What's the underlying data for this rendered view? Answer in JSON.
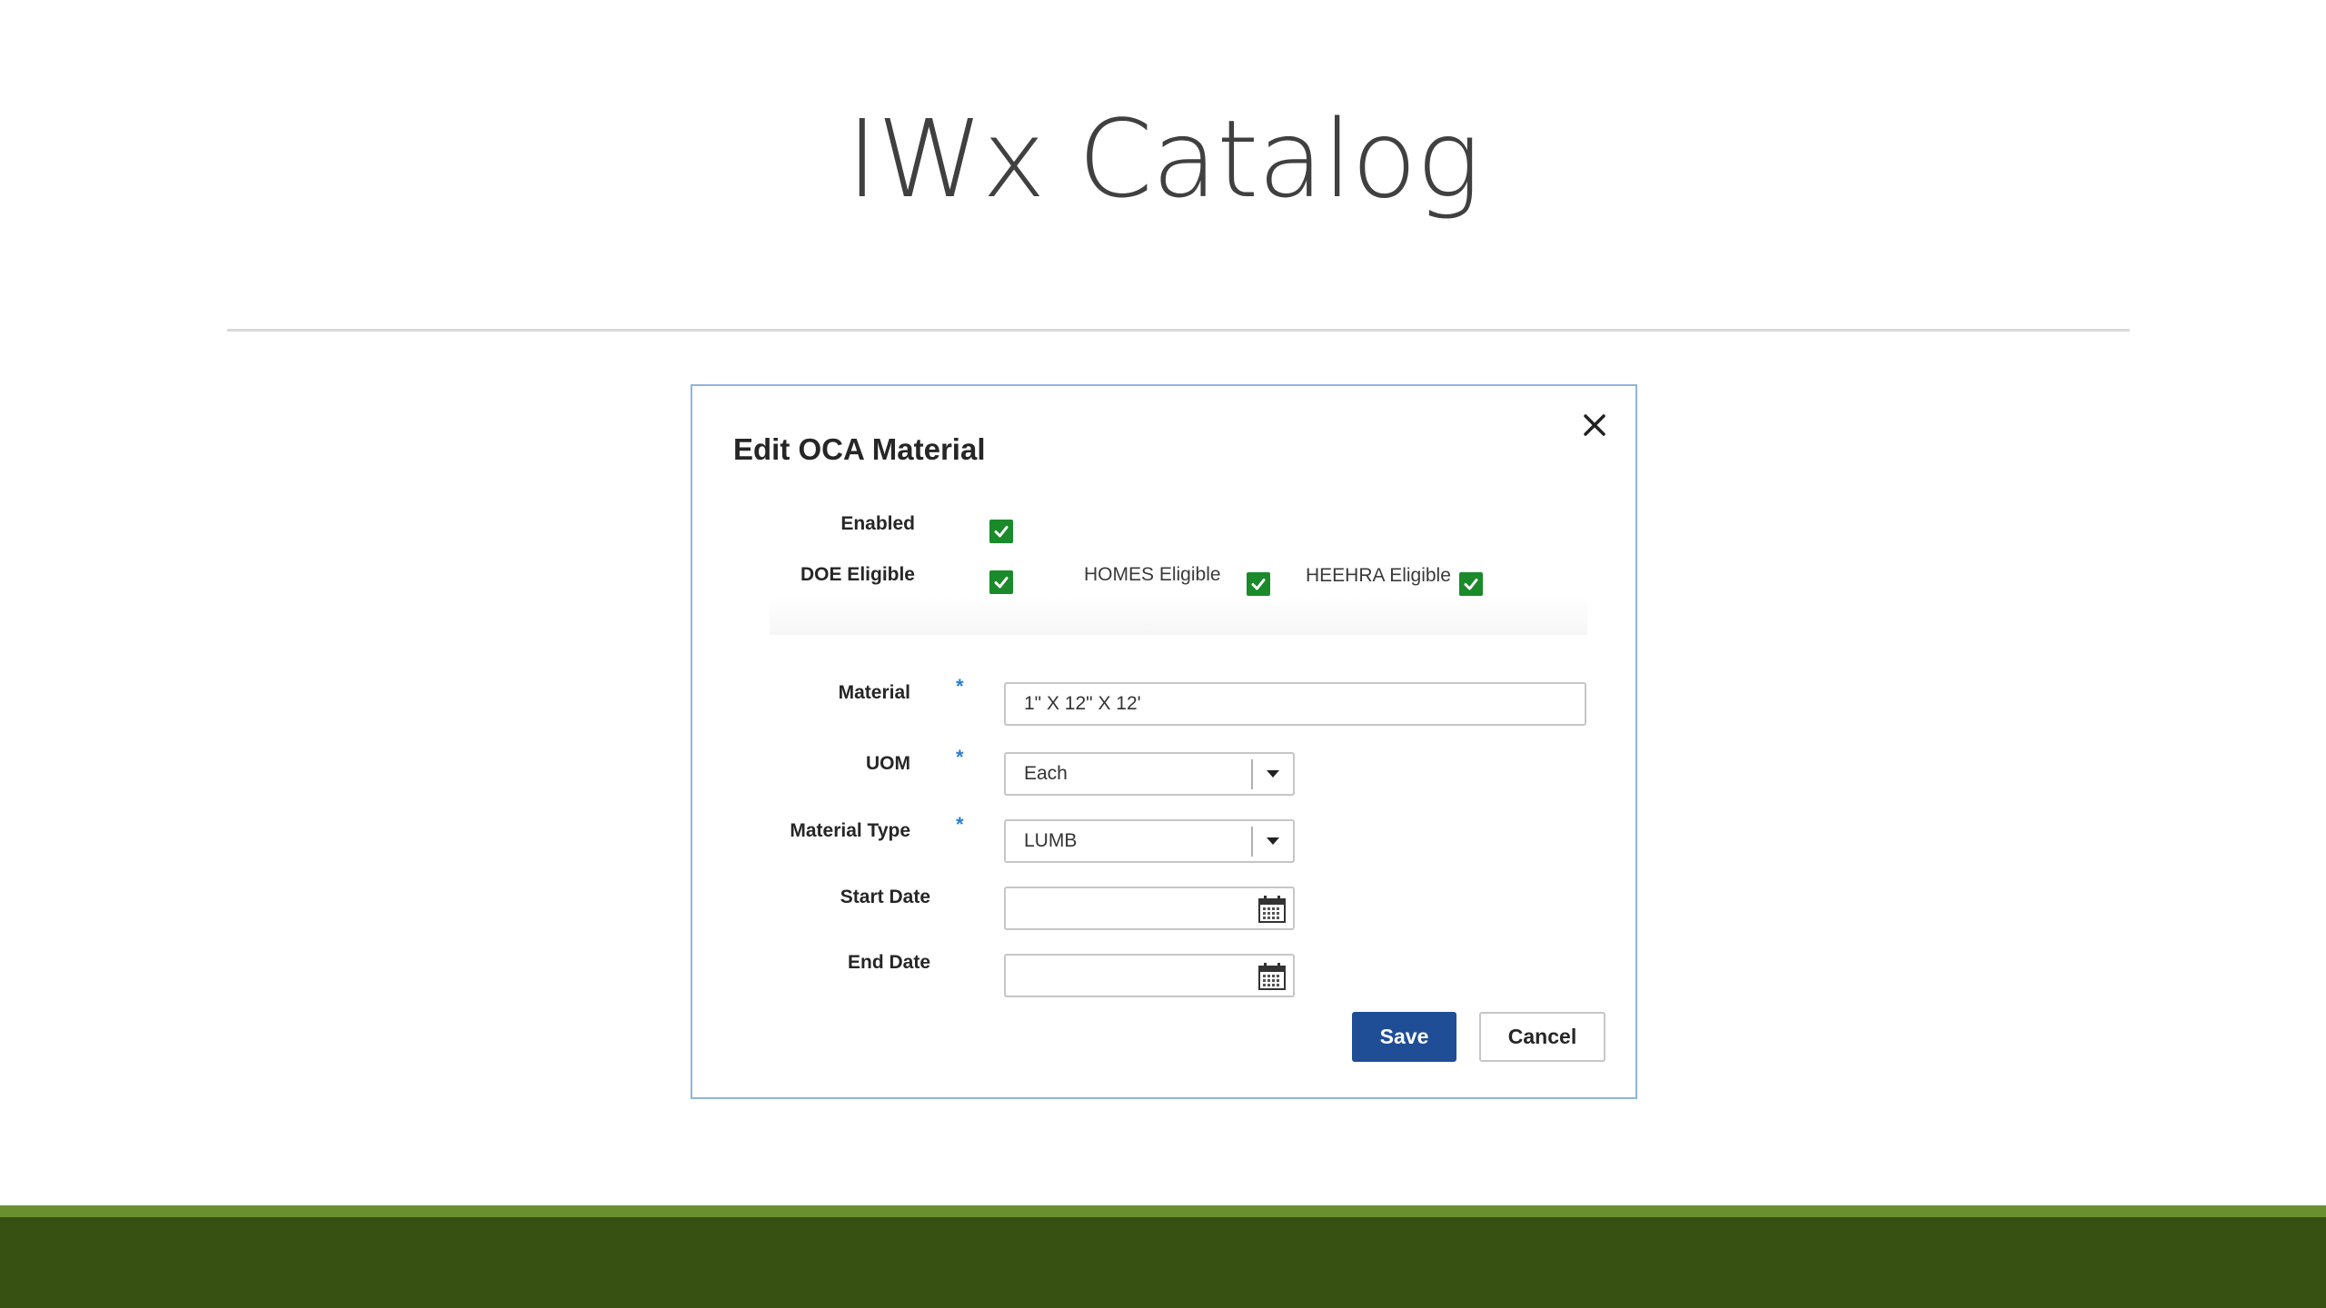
{
  "slide": {
    "title": "IWx Catalog"
  },
  "dialog": {
    "title": "Edit OCA Material",
    "close_icon": "close-icon",
    "checkboxes": {
      "enabled": {
        "label": "Enabled",
        "checked": true
      },
      "doe_eligible": {
        "label": "DOE Eligible",
        "checked": true
      },
      "homes_eligible": {
        "label": "HOMES Eligible",
        "checked": true
      },
      "heehra_eligible": {
        "label": "HEEHRA Eligible",
        "checked": true
      }
    },
    "fields": {
      "material": {
        "label": "Material",
        "required_mark": "*",
        "value": "1\" X 12\" X 12'"
      },
      "uom": {
        "label": "UOM",
        "required_mark": "*",
        "value": "Each"
      },
      "material_type": {
        "label": "Material Type",
        "required_mark": "*",
        "value": "LUMB"
      },
      "start_date": {
        "label": "Start Date",
        "value": "",
        "icon": "calendar-icon"
      },
      "end_date": {
        "label": "End Date",
        "value": "",
        "icon": "calendar-icon"
      }
    },
    "buttons": {
      "save": "Save",
      "cancel": "Cancel"
    }
  },
  "colors": {
    "save_button": "#1f4e96",
    "checkbox": "#1a8a2a",
    "required_mark": "#2a7fd0",
    "footer_band": "#375112",
    "footer_accent": "#6a8f2f",
    "dialog_border": "#8fb4de"
  }
}
